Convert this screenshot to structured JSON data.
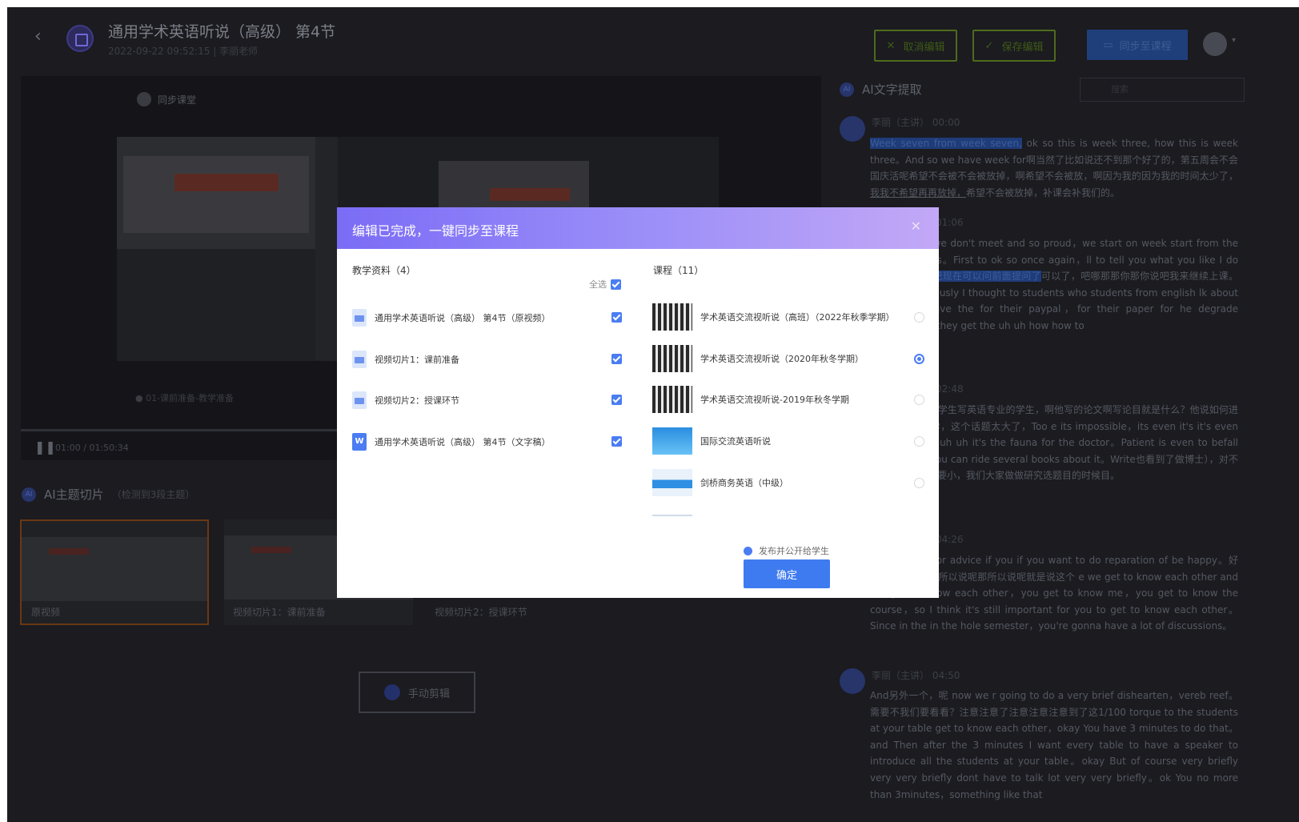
{
  "header": {
    "back_icon": "chevron-left-icon",
    "title": "通用学术英语听说（高级） 第4节",
    "subtitle": "2022-09-22 09:52:15 | 李丽老师",
    "cancel_label": "取消编辑",
    "save_label": "保存编辑",
    "sync_label": "同步至课程"
  },
  "video": {
    "sync_chip_label": "同步课堂",
    "caption": "● 01-课前准备-教学准备",
    "time_current": "01:00",
    "time_total": "/ 01:50:34"
  },
  "ai_slices": {
    "title": "AI主题切片",
    "subtitle": "（检测到3段主题）",
    "items": [
      {
        "label": "原视频"
      },
      {
        "label": "视频切片1：课前准备"
      },
      {
        "label": "视频切片2：授课环节"
      }
    ],
    "manual_button": "手动剪辑"
  },
  "transcript": {
    "title": "AI文字提取",
    "search_placeholder": "搜索",
    "blocks": [
      {
        "speaker": "李丽（主讲）",
        "time": "00:00",
        "segments": [
          {
            "text": "Week seven from week seven,",
            "style": "hl"
          },
          {
            "text": " ok so this is week three, how this is week three。And so we have week for啊当然了比如说还不到那个好了的，第五周会不会国庆活呢希望不会被不会被放掉，啊希望不会被放，啊因为我的因为我的时间太少了，",
            "style": ""
          },
          {
            "text": "我我不希望再再放掉，",
            "style": "ul"
          },
          {
            "text": "希望不会被放掉，补课会补我们的。",
            "style": ""
          }
        ]
      },
      {
        "speaker": "",
        "time": "01:06",
        "segments": [
          {
            "text": "for week six we don't meet and so proud，we start on week start from the first to group's。First to ok so once again，ll to tell you what you like I do for，",
            "style": ""
          },
          {
            "text": "现在可以把现在可以问前面提问了",
            "style": "hl"
          },
          {
            "text": "可以了，吧哪那那你那你说吧我来继续上课。啊 And so eviously I thought to students who students from english lk about they They have the for their paypal，for their paper for he degrade dissertation，they get the uh uh how how to",
            "style": ""
          }
        ]
      },
      {
        "speaker": "",
        "time": "02:48",
        "segments": [
          {
            "text": "为说之前我知道学生写英语专业的学生，啊他写的论文啊写论目就是什么？他说如何进行小学英语教学，这个话题太大了，Too e its impossible，its even it's it's even to big for the uh uh it's the fauna for the doctor。Patient is even to befall dockter use you can ride several books about it。Write也看到了做博士），对不对啊，所以一定要小，我们大家做做研究选题目的时候目。",
            "style": ""
          }
        ]
      },
      {
        "speaker": "",
        "time": "04:26",
        "segments": [
          {
            "text": "you can ask for advice if you if you want to do reparation of be happy。好的，所以说呢那所以说呢那所以说呢就是说这个 e we get to know each other and not get to know each other，you get to know me，you get to know the course，so I think it's still important for you to get to know each other。Since in the in the hole semester，you're gonna have a lot of discussions。",
            "style": ""
          }
        ]
      },
      {
        "speaker": "李丽（主讲）",
        "time": "04:50",
        "segments": [
          {
            "text": "And另外一个，呢 now we r going to do a very brief dishearten，vereb reef。需要不我们要看看？注意注意了注意注意注意到了这1/100 torque to the students at your table get to know each other，okay You have 3 minutes to do that。and Then after the 3 minutes I want every table to have a speaker to introduce all the students at your table。okay But of course very briefly very very briefly dont have to talk lot very very briefly。ok You no more than 3minutes，something like that",
            "style": ""
          }
        ]
      }
    ]
  },
  "modal": {
    "title": "编辑已完成，一键同步至课程",
    "close_icon": "close-icon",
    "materials": {
      "title": "教学资料（4）",
      "select_all": "全选",
      "items": [
        {
          "label": "通用学术英语听说（高级） 第4节（原视频）",
          "icon": "video-file-icon",
          "checked": true
        },
        {
          "label": "视频切片1：课前准备",
          "icon": "video-file-icon",
          "checked": true
        },
        {
          "label": "视频切片2：授课环节",
          "icon": "video-file-icon",
          "checked": true
        },
        {
          "label": "通用学术英语听说（高级） 第4节（文字稿）",
          "icon": "word-file-icon",
          "icon_text": "W",
          "checked": true
        }
      ]
    },
    "courses": {
      "title": "课程（11）",
      "items": [
        {
          "label": "学术英语交流视听说（高班）（2022年秋季学期）",
          "selected": false
        },
        {
          "label": "学术英语交流视听说（2020年秋冬学期）",
          "selected": true
        },
        {
          "label": "学术英语交流视听说-2019年秋冬学期",
          "selected": false
        },
        {
          "label": "国际交流英语听说",
          "selected": false
        },
        {
          "label": "剑桥商务英语（中级）",
          "selected": false
        }
      ]
    },
    "publish_label": "发布并公开给学生",
    "confirm_label": "确定"
  },
  "colors": {
    "accent": "#3f7bf0",
    "modal_gradient_start": "#7b6cf6",
    "modal_gradient_end": "#c3a8f6",
    "app_background": "#1b1b20"
  }
}
